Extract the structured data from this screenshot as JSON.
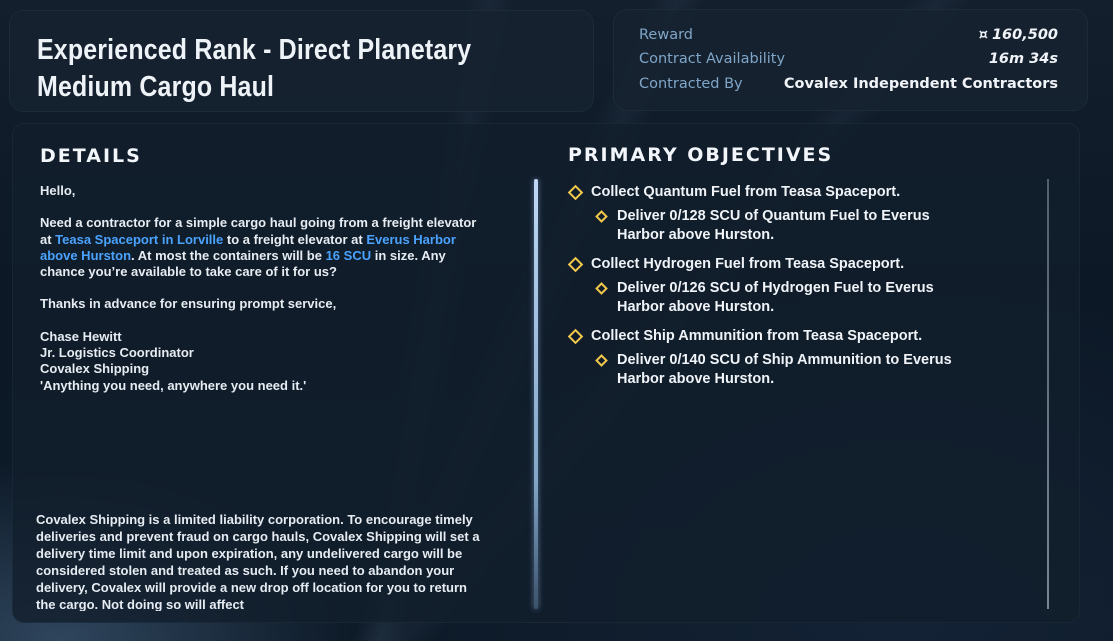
{
  "mission": {
    "title": "Experienced Rank - Direct Planetary Medium Cargo Haul"
  },
  "info": {
    "reward_label": "Reward",
    "reward_value": "160,500",
    "reward_icon": "currency-icon",
    "currency_glyph": "¤",
    "availability_label": "Contract Availability",
    "availability_value": "16m 34s",
    "contracted_by_label": "Contracted By",
    "contracted_by_value": "Covalex Independent Contractors"
  },
  "details": {
    "heading": "DETAILS",
    "greeting": "Hello,",
    "body_part1": "Need a contractor for a simple cargo haul going from a freight elevator at ",
    "pickup_link": "Teasa Spaceport in Lorville",
    "body_part2": " to a freight elevator at ",
    "dropoff_link": "Everus Harbor above Hurston",
    "body_part3": ". At most the containers will be ",
    "size_link": "16 SCU",
    "body_part4": " in size. Any chance you’re available to take care of it for us?",
    "thanks": "Thanks in advance for ensuring prompt service,",
    "signature": {
      "name": "Chase Hewitt",
      "role": "Jr. Logistics Coordinator",
      "company": "Covalex Shipping",
      "motto": "'Anything you need, anywhere you need it.'"
    },
    "disclaimer": "Covalex Shipping is a limited liability corporation. To encourage timely deliveries and prevent fraud on cargo hauls, Covalex Shipping will set a delivery time limit and upon expiration, any undelivered cargo will be considered stolen and treated as such. If you need to abandon your delivery, Covalex will provide a new drop off location for you to return the cargo. Not doing so will affect"
  },
  "objectives": {
    "heading": "PRIMARY OBJECTIVES",
    "items": [
      {
        "main": "Collect Quantum Fuel from Teasa Spaceport.",
        "sub": "Deliver 0/128 SCU of Quantum Fuel to Everus Harbor above Hurston."
      },
      {
        "main": "Collect Hydrogen Fuel from Teasa Spaceport.",
        "sub": "Deliver 0/126 SCU of Hydrogen Fuel to Everus Harbor above Hurston."
      },
      {
        "main": "Collect Ship Ammunition from Teasa Spaceport.",
        "sub": "Deliver 0/140 SCU of Ship Ammunition to Everus Harbor above Hurston."
      }
    ]
  },
  "colors": {
    "accent_link": "#4aa3ff",
    "objective_marker": "#f2c94c",
    "label": "#7fa6c8"
  }
}
